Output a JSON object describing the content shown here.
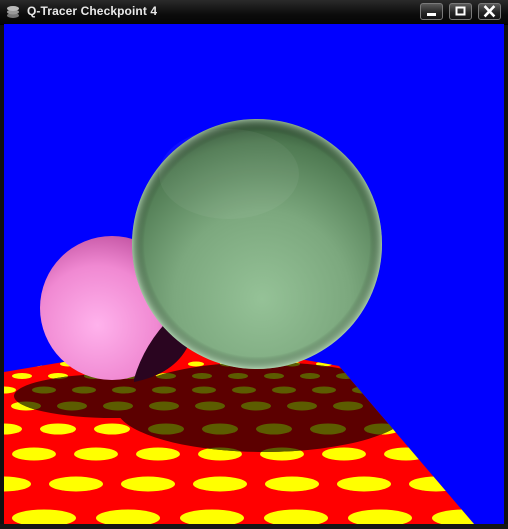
{
  "window": {
    "title": "Q-Tracer Checkpoint 4",
    "app_icon": "stack-icon",
    "buttons": [
      {
        "name": "minimize-button",
        "icon": "minimize-icon"
      },
      {
        "name": "maximize-button",
        "icon": "maximize-icon"
      },
      {
        "name": "close-button",
        "icon": "close-icon"
      }
    ]
  },
  "scene": {
    "background_color": "#0000ff",
    "floor_color": "#ff0000",
    "dot_color": "#ffff00",
    "shadow_floor_color": "#5c0000",
    "shadow_dot_color": "#5c5c00",
    "spheres": [
      {
        "name": "pink-sphere",
        "color": "#ff9be0"
      },
      {
        "name": "green-sphere",
        "color": "#8fbc8f"
      }
    ]
  }
}
